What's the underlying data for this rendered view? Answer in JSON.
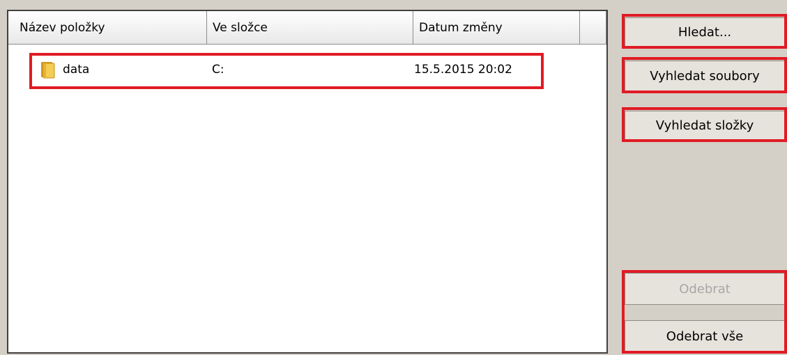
{
  "listview": {
    "columns": [
      "Název položky",
      "Ve složce",
      "Datum změny",
      ""
    ],
    "rows": [
      {
        "name": "data",
        "folder": "C:",
        "date": "15.5.2015 20:02",
        "icon": "folder-icon"
      }
    ]
  },
  "buttons": {
    "search": "Hledat...",
    "find_files": "Vyhledat soubory",
    "find_folders": "Vyhledat složky",
    "remove": "Odebrat",
    "remove_all": "Odebrat vše"
  },
  "colors": {
    "highlight": "#e01b24",
    "window_bg": "#d4d0c8",
    "folder": "#e8b92f"
  }
}
